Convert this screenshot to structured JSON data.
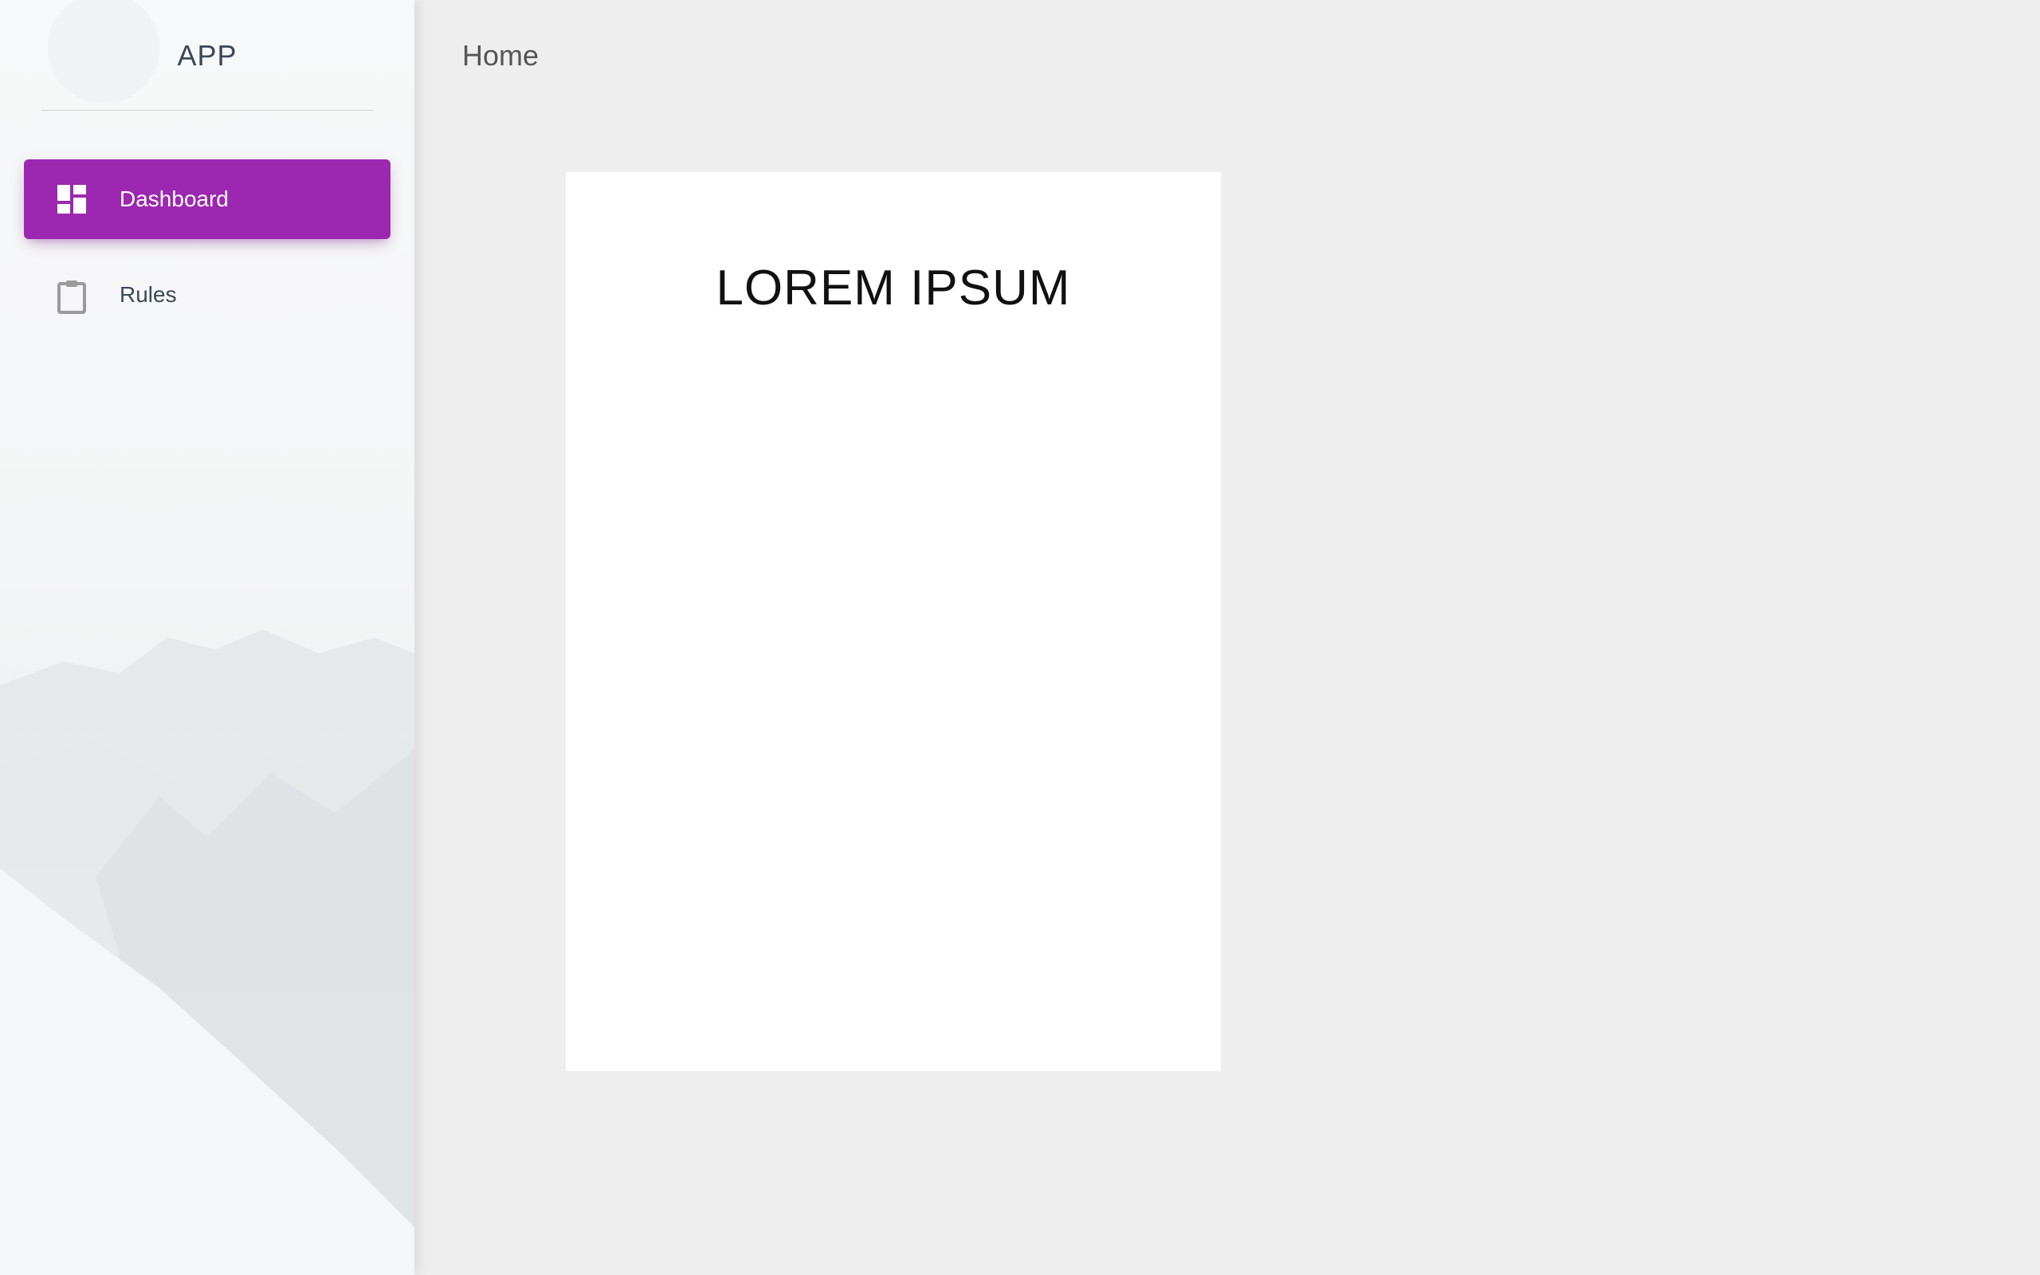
{
  "app": {
    "logo_text": "APP"
  },
  "sidebar": {
    "items": [
      {
        "label": "Dashboard",
        "icon": "dashboard-icon",
        "active": true
      },
      {
        "label": "Rules",
        "icon": "clipboard-icon",
        "active": false
      }
    ]
  },
  "header": {
    "title": "Home"
  },
  "main": {
    "card_title": "LOREM IPSUM"
  },
  "colors": {
    "accent": "#9c27b0",
    "background": "#eeeeee",
    "card": "#ffffff",
    "text": "#3c4858"
  }
}
